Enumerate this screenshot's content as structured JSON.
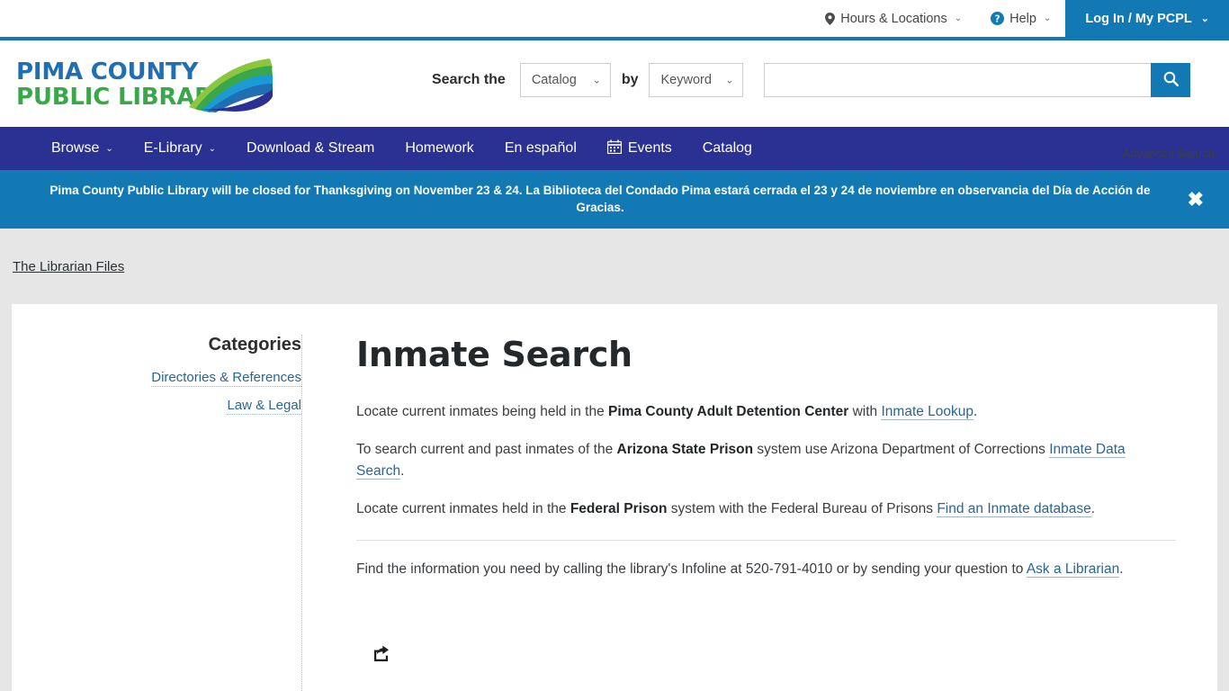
{
  "topbar": {
    "hours_locations": "Hours & Locations",
    "help": "Help",
    "login": "Log In / My PCPL",
    "caret": "⌄"
  },
  "header": {
    "logo_line1": "PIMA COUNTY",
    "logo_line2": "PUBLIC LIBRARY",
    "search_the_label": "Search the",
    "catalog_select": "Catalog",
    "by_label": "by",
    "keyword_select": "Keyword",
    "search_placeholder": "",
    "search_value": "",
    "advanced_search": "Advanced Search"
  },
  "nav": {
    "items": [
      {
        "label": "Browse",
        "has_caret": true,
        "icon": ""
      },
      {
        "label": "E-Library",
        "has_caret": true,
        "icon": ""
      },
      {
        "label": "Download & Stream",
        "has_caret": false,
        "icon": ""
      },
      {
        "label": "Homework",
        "has_caret": false,
        "icon": ""
      },
      {
        "label": "En español",
        "has_caret": false,
        "icon": ""
      },
      {
        "label": "Events",
        "has_caret": false,
        "icon": "calendar-icon"
      },
      {
        "label": "Catalog",
        "has_caret": false,
        "icon": ""
      }
    ]
  },
  "alert": {
    "text": "Pima County Public Library will be closed for Thanksgiving on November 23 & 24. La Biblioteca del Condado Pima estará cerrada el 23 y 24 de noviembre en observancia del Día de Acción de Gracias.",
    "close": "✖"
  },
  "breadcrumb": {
    "label": "The Librarian Files"
  },
  "sidebar": {
    "title": "Categories",
    "categories": [
      "Directories & References",
      "Law & Legal"
    ]
  },
  "main": {
    "title": "Inmate Search",
    "p1": {
      "t1": "Locate current inmates being held in the ",
      "b1": "Pima County Adult Detention Center",
      "t2": " with ",
      "a1": "Inmate Lookup",
      "t3": "."
    },
    "p2": {
      "t1": "To search current and past inmates of the ",
      "b1": "Arizona State Prison",
      "t2": " system use Arizona Department of Corrections ",
      "a1": "Inmate Data Search",
      "t3": "."
    },
    "p3": {
      "t1": "Locate current inmates held in the ",
      "b1": "Federal Prison",
      "t2": " system with the Federal Bureau of Prisons ",
      "a1": "Find an Inmate database",
      "t3": "."
    },
    "p4": {
      "t1": "Find the information you need by calling the library's Infoline at 520-791-4010 or by sending your question to ",
      "a1": "Ask a Librarian",
      "t2": "."
    }
  },
  "colors": {
    "brand_blue": "#1279b4",
    "nav_navy": "#2b3192",
    "logo_blue": "#1f6fb2",
    "logo_green": "#3aa84a",
    "link_blue": "#2a6496",
    "page_bg": "#e6e6e6"
  }
}
